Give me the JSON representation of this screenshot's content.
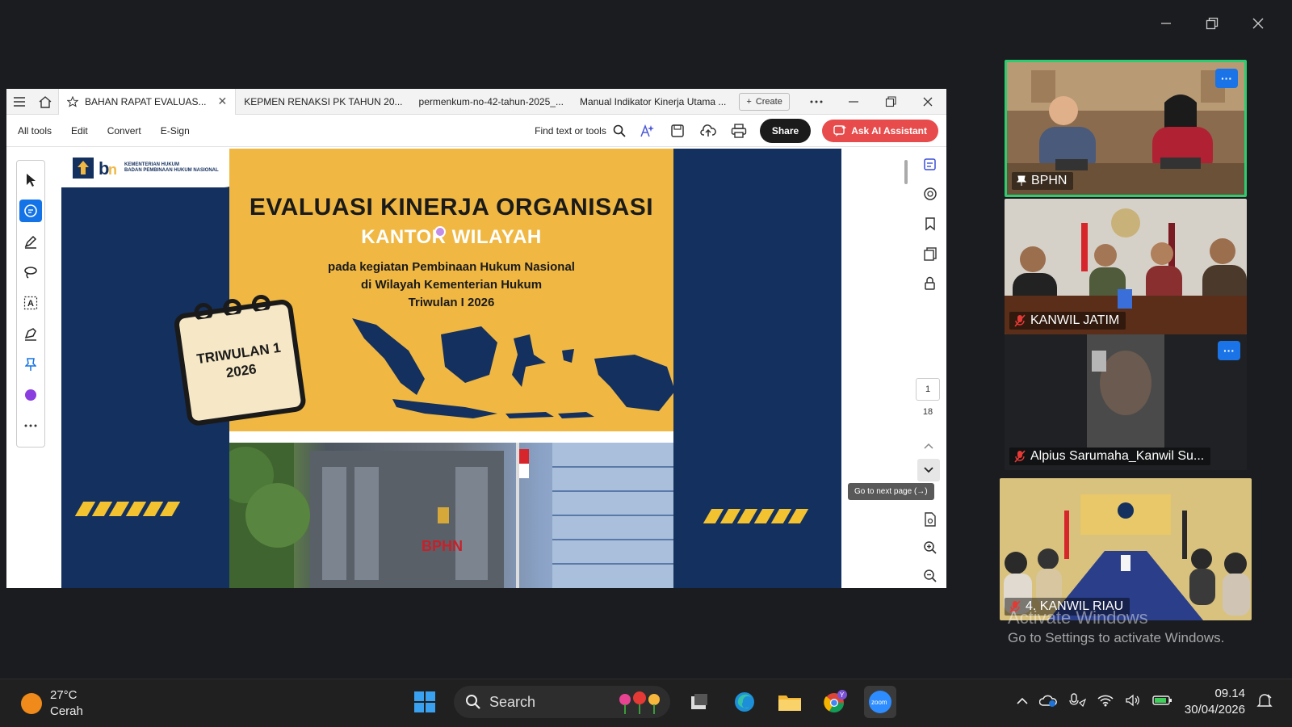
{
  "acrobat": {
    "tabs": [
      {
        "label": "BAHAN RAPAT EVALUAS..."
      },
      {
        "label": "KEPMEN RENAKSI PK TAHUN 20..."
      },
      {
        "label": "permenkum-no-42-tahun-2025_..."
      },
      {
        "label": "Manual Indikator Kinerja Utama ..."
      }
    ],
    "create_label": "Create",
    "menu": [
      "All tools",
      "Edit",
      "Convert",
      "E-Sign"
    ],
    "find_label": "Find text or tools",
    "share_label": "Share",
    "ai_label": "Ask AI Assistant",
    "page_current": "1",
    "page_total": "18",
    "tooltip": "Go to next page (→)"
  },
  "slide": {
    "logo_line1": "KEMENTERIAN HUKUM",
    "logo_line2": "BADAN PEMBINAAN HUKUM NASIONAL",
    "title1": "EVALUASI KINERJA ORGANISASI",
    "title2": "KANTOR WILAYAH",
    "subtitle_line1": "pada kegiatan Pembinaan Hukum Nasional",
    "subtitle_line2": "di Wilayah Kementerian Hukum",
    "subtitle_line3": "Triwulan I 2026",
    "calendar_line1": "TRIWULAN 1",
    "calendar_line2": "2026",
    "building_sign": "BPHN"
  },
  "participants": [
    {
      "name": "BPHN",
      "muted": false,
      "pinned": true
    },
    {
      "name": "KANWIL JATIM",
      "muted": true
    },
    {
      "name": "Alpius Sarumaha_Kanwil Su...",
      "muted": true
    },
    {
      "name": "4. KANWIL RIAU",
      "muted": true
    }
  ],
  "watermark": {
    "title": "Activate Windows",
    "subtitle": "Go to Settings to activate Windows."
  },
  "taskbar": {
    "temperature": "27°C",
    "condition": "Cerah",
    "search_placeholder": "Search",
    "time": "09.14",
    "date": "30/04/2026"
  },
  "colors": {
    "slide_navy": "#14305e",
    "slide_gold": "#f0b843",
    "active_speaker": "#2ecc71",
    "zoom_blue": "#1a74e8",
    "ai_button": "#e84b4b"
  }
}
